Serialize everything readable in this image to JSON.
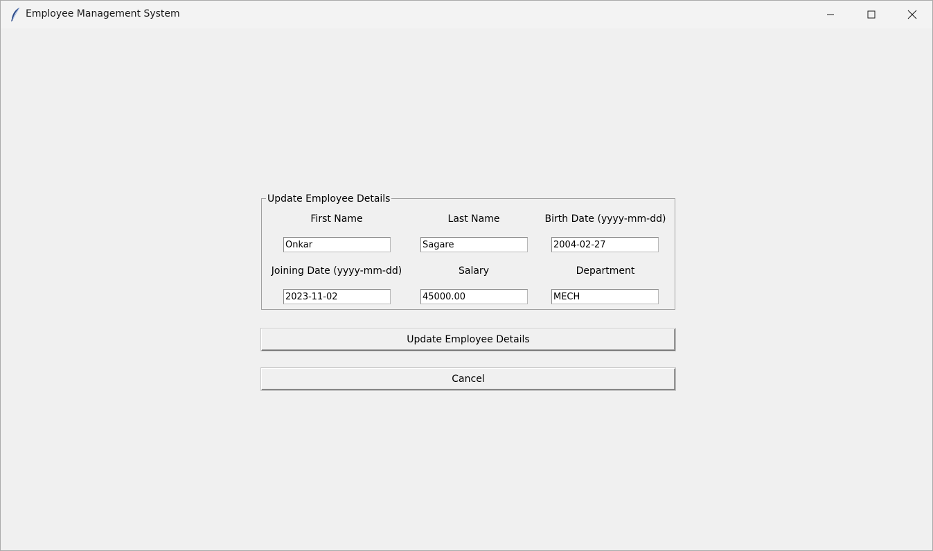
{
  "window": {
    "title": "Employee Management System",
    "icon": "feather-icon"
  },
  "form": {
    "group_title": "Update Employee Details",
    "fields": {
      "first_name": {
        "label": "First Name",
        "value": "Onkar"
      },
      "last_name": {
        "label": "Last Name",
        "value": "Sagare"
      },
      "birth_date": {
        "label": "Birth Date (yyyy-mm-dd)",
        "value": "2004-02-27"
      },
      "joining_date": {
        "label": "Joining Date (yyyy-mm-dd)",
        "value": "2023-11-02"
      },
      "salary": {
        "label": "Salary",
        "value": "45000.00"
      },
      "department": {
        "label": "Department",
        "value": "MECH"
      }
    }
  },
  "buttons": {
    "update_label": "Update Employee Details",
    "cancel_label": "Cancel"
  }
}
